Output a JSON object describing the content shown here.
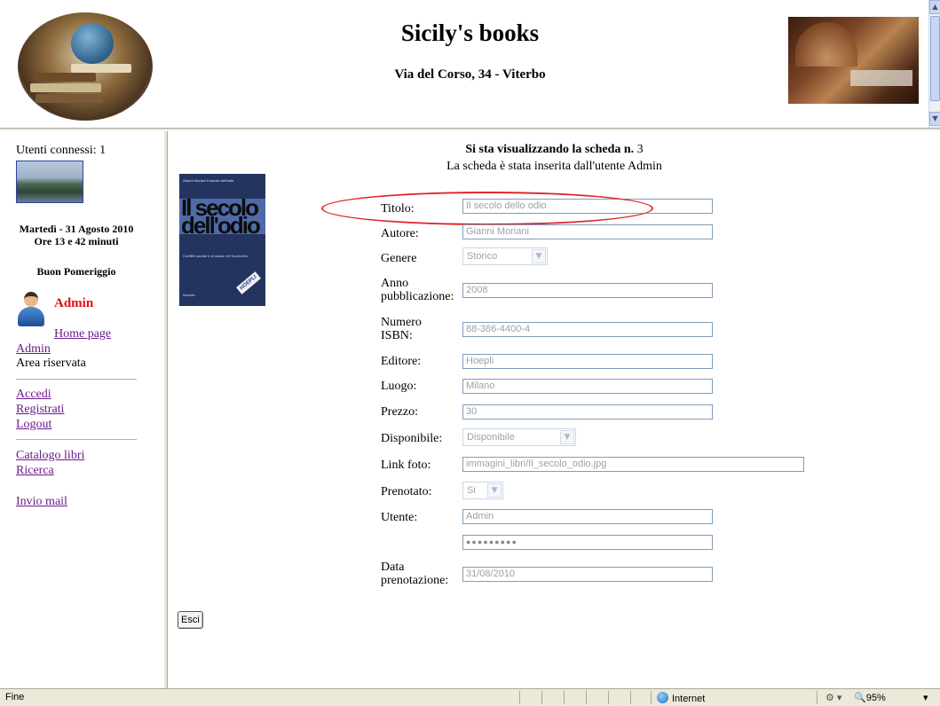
{
  "header": {
    "title": "Sicily's books",
    "address": "Via del Corso, 34 - Viterbo"
  },
  "sidebar": {
    "users_connected": "Utenti connessi: 1",
    "date": "Martedì - 31 Agosto 2010",
    "time": "Ore 13 e 42 minuti",
    "greeting": "Buon Pomeriggio",
    "user_name": "Admin",
    "links": {
      "home": "Home page",
      "admin": "Admin",
      "reserved": "Area riservata",
      "login": "Accedi",
      "register": "Registrati",
      "logout": "Logout",
      "catalog": "Catalogo libri",
      "search": "Ricerca",
      "mail": "Invio mail"
    }
  },
  "card": {
    "title_prefix": "Si sta visualizzando la scheda n.",
    "number": "3",
    "inserted_by": "La scheda è stata inserita dall'utente Admin",
    "cover": {
      "header_text": "Gianni Moriani  Il secolo dell'odio",
      "title_text": "Il secolo dell'odio",
      "subtitle_text": "Conflitti razziali e di classe nel Novecento",
      "badge": "HOEPLI",
      "publisher_text": "Marsilio"
    },
    "fields": {
      "titolo": {
        "label": "Titolo:",
        "value": "Il secolo dello odio"
      },
      "autore": {
        "label": "Autore:",
        "value": "Gianni Moriani"
      },
      "genere": {
        "label": "Genere",
        "value": "Storico"
      },
      "anno": {
        "label": "Anno pubblicazione:",
        "value": "2008"
      },
      "isbn": {
        "label": "Numero ISBN:",
        "value": "88-386-4400-4"
      },
      "editore": {
        "label": "Editore:",
        "value": "Hoepli"
      },
      "luogo": {
        "label": "Luogo:",
        "value": "Milano"
      },
      "prezzo": {
        "label": "Prezzo:",
        "value": "30"
      },
      "disponibile": {
        "label": "Disponibile:",
        "value": "Disponibile"
      },
      "link_foto": {
        "label": "Link foto:",
        "value": "immagini_libri/Il_secolo_odio.jpg"
      },
      "prenotato": {
        "label": "Prenotato:",
        "value": "Si"
      },
      "utente": {
        "label": "Utente:",
        "value": "Admin"
      },
      "password": {
        "label": "",
        "value": "●●●●●●●●●"
      },
      "data_prenotazione": {
        "label": "Data prenotazione:",
        "value": "31/08/2010"
      }
    },
    "exit_button": "Esci"
  },
  "statusbar": {
    "status": "Fine",
    "zone": "Internet",
    "zoom": "95%"
  },
  "colors": {
    "link": "#6a1b8a",
    "admin_name": "#e01010",
    "highlight": "#e0262b",
    "input_border": "#7f9db9"
  },
  "icons": [
    "scroll-up-arrow-icon",
    "scroll-down-arrow-icon",
    "user-avatar-icon",
    "select-arrow-icon",
    "internet-globe-icon",
    "zoom-icon"
  ]
}
